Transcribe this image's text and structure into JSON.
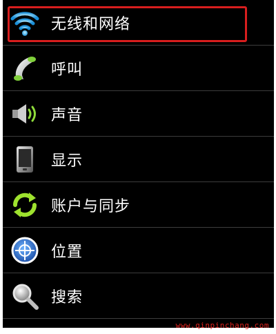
{
  "settings": {
    "items": [
      {
        "label": "无线和网络",
        "icon": "wifi-icon"
      },
      {
        "label": "呼叫",
        "icon": "phone-icon"
      },
      {
        "label": "声音",
        "icon": "speaker-icon"
      },
      {
        "label": "显示",
        "icon": "display-icon"
      },
      {
        "label": "账户与同步",
        "icon": "sync-icon"
      },
      {
        "label": "位置",
        "icon": "location-icon"
      },
      {
        "label": "搜索",
        "icon": "search-icon"
      }
    ]
  },
  "highlight_color": "#d81e1e",
  "watermark": "www.qinpinchang.com"
}
